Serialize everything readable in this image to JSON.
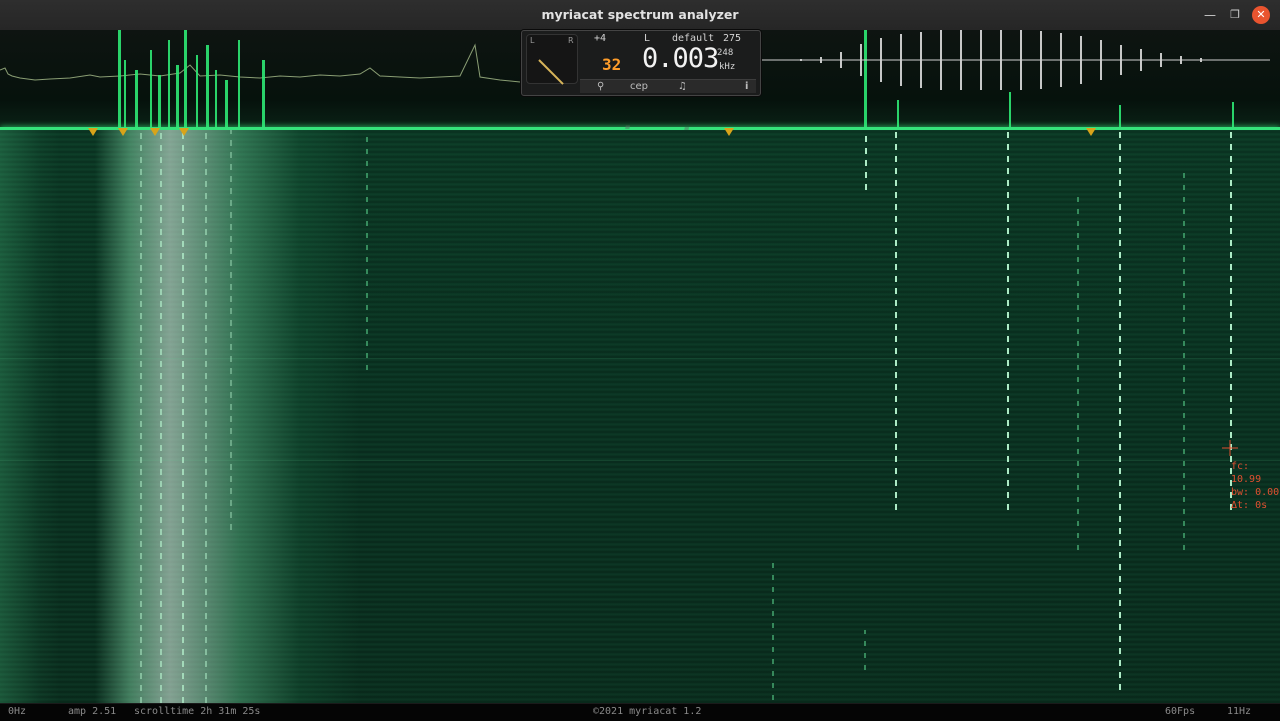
{
  "window": {
    "title": "myriacat spectrum analyzer",
    "controls": {
      "minimize": "—",
      "maximize": "❐",
      "close": "✕"
    }
  },
  "panel": {
    "gauge_left": "L",
    "gauge_right": "R",
    "offset": "+4",
    "channel": "L",
    "preset": "default",
    "preset_value_top": "275",
    "preset_value_bottom": "248",
    "orange_value": "32",
    "frequency": "0.003",
    "unit": "kHz",
    "buttons": {
      "tuning": "⚲",
      "cep": "cep",
      "note": "♫",
      "info": "i"
    }
  },
  "watermark": "myriacat",
  "readout": {
    "fc": "fc: 10.99",
    "bw": "bw: 0.00",
    "dt": "Δt: 0s"
  },
  "status": {
    "freq_start": "0Hz",
    "amp": "amp 2.51",
    "scrolltime": "scrolltime 2h 31m 25s",
    "copyright": "©2021 myriacat 1.2",
    "fps": "60Fps",
    "freq_end": "11Hz"
  },
  "colors": {
    "accent_green": "#35e27a",
    "marker": "#d8a41a",
    "close_button": "#e9542f",
    "readout": "#e05030"
  }
}
